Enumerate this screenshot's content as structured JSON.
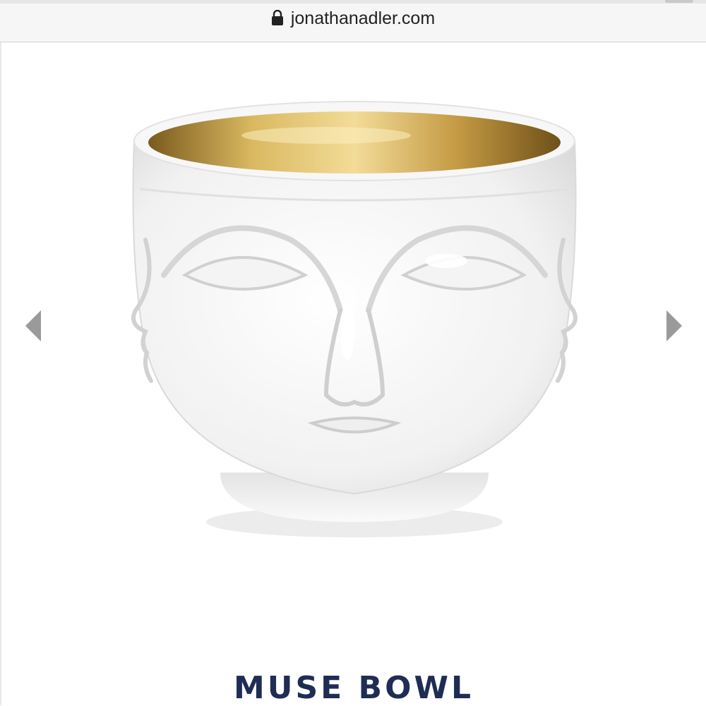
{
  "browser": {
    "url": "jonathanadler.com",
    "lock_icon": "lock-icon"
  },
  "gallery": {
    "prev_icon": "chevron-left-icon",
    "next_icon": "chevron-right-icon",
    "image_subject": "white ceramic bowl with face relief and gold interior"
  },
  "product": {
    "title": "MUSE BOWL"
  },
  "colors": {
    "title": "#1f2d55",
    "arrow": "#9a9a9a",
    "gold": "#c9a14a"
  }
}
